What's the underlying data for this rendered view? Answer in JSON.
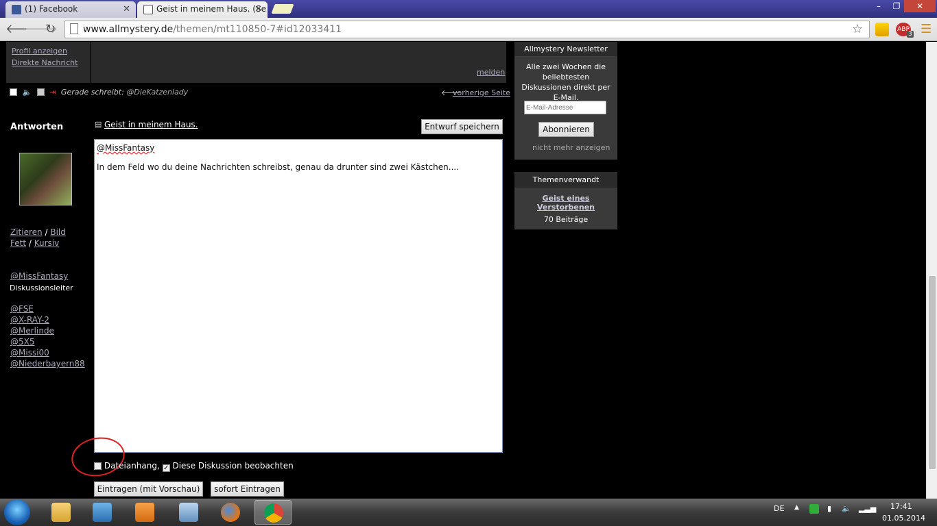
{
  "browser": {
    "tabs": [
      {
        "label": "(1) Facebook",
        "active": false
      },
      {
        "label": "Geist in meinem Haus. (Se",
        "active": false
      }
    ],
    "window_buttons": [
      "–",
      "❐",
      "✕"
    ],
    "url_host": "www.allmystery.de",
    "url_path": "/themen/mt110850-7#id12033411",
    "ext_badge": "3"
  },
  "profile": {
    "view_profile": "Profil anzeigen",
    "direct_message": "Direkte Nachricht",
    "report": "melden"
  },
  "status": {
    "typing_label": "Gerade schreibt:",
    "typing_user": "@DieKatzenlady",
    "prev_page": "vorherige Seite"
  },
  "reply": {
    "title": "Antworten",
    "topic_link": "Geist in meinem Haus.",
    "save_draft": "Entwurf speichern",
    "editor_line1": "@MissFantasy",
    "editor_line2": "In dem Feld wo du deine Nachrichten schreibst, genau da drunter sind zwei Kästchen....",
    "format": {
      "quote": "Zitieren",
      "image": "Bild",
      "bold": "Fett",
      "italic": "Kursiv",
      "sep": "/"
    },
    "moderator": {
      "name": "@MissFantasy",
      "role": "Diskussionsleiter"
    },
    "participants": [
      "@FSE",
      "@X-RAY-2",
      "@Merlinde",
      "@5X5",
      "@Missi00",
      "@Niederbayern88"
    ],
    "attachment_label": "Dateianhang,",
    "attachment_checked": false,
    "watch_label": "Diese Diskussion beobachten",
    "watch_checked": true,
    "submit_preview": "Eintragen (mit Vorschau)",
    "submit_now": "sofort Eintragen"
  },
  "newsletter": {
    "title": "Allmystery Newsletter",
    "text": "Alle zwei Wochen die beliebtesten Diskussionen direkt per E-Mail.",
    "email_placeholder": "E-Mail-Adresse",
    "subscribe": "Abonnieren",
    "dismiss": "nicht mehr anzeigen"
  },
  "related": {
    "title": "Themenverwandt",
    "topic": "Geist eines Verstorbenen",
    "count": "70 Beiträge"
  },
  "taskbar": {
    "lang": "DE",
    "time": "17:41",
    "date": "01.05.2014"
  },
  "colors": {
    "accent": "#3b3a8f",
    "link": "#aaaabb",
    "annotation": "#dd2222"
  }
}
